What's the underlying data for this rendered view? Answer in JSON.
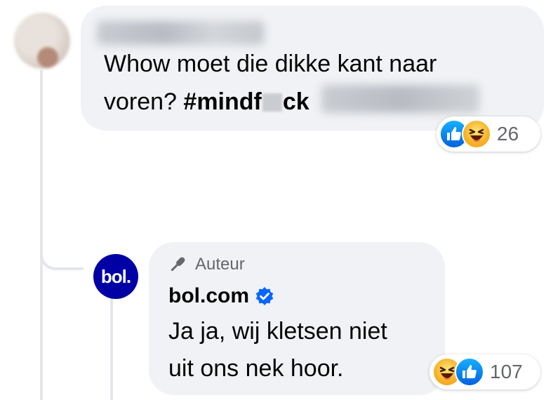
{
  "comment1": {
    "author": "",
    "text_line1": "Whow moet die dikke kant naar",
    "text_line2_prefix": "voren? ",
    "hashtag_start": "#mindf",
    "hashtag_end": "ck",
    "reactions": {
      "icons": [
        "like-icon",
        "haha-icon"
      ],
      "count": "26"
    }
  },
  "comment2": {
    "badge": "Auteur",
    "author": "bol.com",
    "avatar_text": "bol.",
    "verified": true,
    "text_line1": "Ja ja, wij kletsen niet",
    "text_line2": "uit ons nek hoor.",
    "reactions": {
      "icons": [
        "haha-icon",
        "like-icon"
      ],
      "count": "107"
    }
  },
  "colors": {
    "bubble": "#f0f2f5",
    "like_blue": "#0866ff",
    "haha_yellow": "#f7b125",
    "bol_blue": "#0000a4",
    "muted_text": "#65676b"
  }
}
